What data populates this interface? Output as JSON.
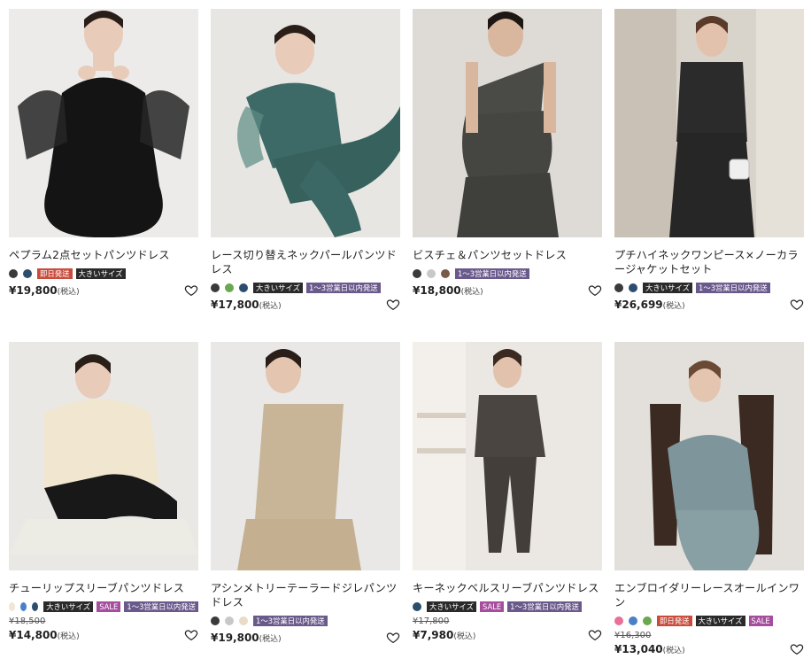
{
  "products": [
    {
      "title": "ペプラム2点セットパンツドレス",
      "colors": [
        "#3a3a3a",
        "#2c4d6e"
      ],
      "badges": [
        {
          "text": "即日発送",
          "color": "#c94b3c"
        },
        {
          "text": "大きいサイズ",
          "color": "#2a2a2a"
        }
      ],
      "old_price": "",
      "price": "¥19,800",
      "tax": "(税込)"
    },
    {
      "title": "レース切り替えネックパールパンツドレス",
      "colors": [
        "#3a3a3a",
        "#6aa84f",
        "#2c4d6e"
      ],
      "badges": [
        {
          "text": "大きいサイズ",
          "color": "#2a2a2a"
        },
        {
          "text": "1〜3営業日以内発送",
          "color": "#6a5a8c"
        }
      ],
      "old_price": "",
      "price": "¥17,800",
      "tax": "(税込)"
    },
    {
      "title": "ビスチェ＆パンツセットドレス",
      "colors": [
        "#3a3a3a",
        "#c8c8c8",
        "#7a5a46"
      ],
      "badges": [
        {
          "text": "1〜3営業日以内発送",
          "color": "#6a5a8c"
        }
      ],
      "old_price": "",
      "price": "¥18,800",
      "tax": "(税込)"
    },
    {
      "title": "プチハイネックワンピース×ノーカラージャケットセット",
      "colors": [
        "#3a3a3a",
        "#2c4d6e"
      ],
      "badges": [
        {
          "text": "大きいサイズ",
          "color": "#2a2a2a"
        },
        {
          "text": "1〜3営業日以内発送",
          "color": "#6a5a8c"
        }
      ],
      "old_price": "",
      "price": "¥26,699",
      "tax": "(税込)"
    },
    {
      "title": "チューリップスリーブパンツドレス",
      "colors": [
        "#f0e6d2",
        "#4a80c8",
        "#2c4d6e"
      ],
      "badges": [
        {
          "text": "大きいサイズ",
          "color": "#2a2a2a"
        },
        {
          "text": "SALE",
          "color": "#a64d9e"
        },
        {
          "text": "1〜3営業日以内発送",
          "color": "#6a5a8c"
        }
      ],
      "old_price": "¥18,500",
      "price": "¥14,800",
      "tax": "(税込)"
    },
    {
      "title": "アシンメトリーテーラードジレパンツドレス",
      "colors": [
        "#3a3a3a",
        "#c8c8c8",
        "#e8dcc8"
      ],
      "badges": [
        {
          "text": "1〜3営業日以内発送",
          "color": "#6a5a8c"
        }
      ],
      "old_price": "",
      "price": "¥19,800",
      "tax": "(税込)"
    },
    {
      "title": "キーネックベルスリーブパンツドレス",
      "colors": [
        "#2c4d6e"
      ],
      "badges": [
        {
          "text": "大きいサイズ",
          "color": "#2a2a2a"
        },
        {
          "text": "SALE",
          "color": "#a64d9e"
        },
        {
          "text": "1〜3営業日以内発送",
          "color": "#6a5a8c"
        }
      ],
      "old_price": "¥17,800",
      "price": "¥7,980",
      "tax": "(税込)"
    },
    {
      "title": "エンブロイダリーレースオールインワン",
      "colors": [
        "#e8709a",
        "#4a80c8",
        "#6aa84f"
      ],
      "badges": [
        {
          "text": "即日発送",
          "color": "#c94b3c"
        },
        {
          "text": "大きいサイズ",
          "color": "#2a2a2a"
        },
        {
          "text": "SALE",
          "color": "#a64d9e"
        }
      ],
      "old_price": "¥16,300",
      "price": "¥13,040",
      "tax": "(税込)"
    }
  ]
}
